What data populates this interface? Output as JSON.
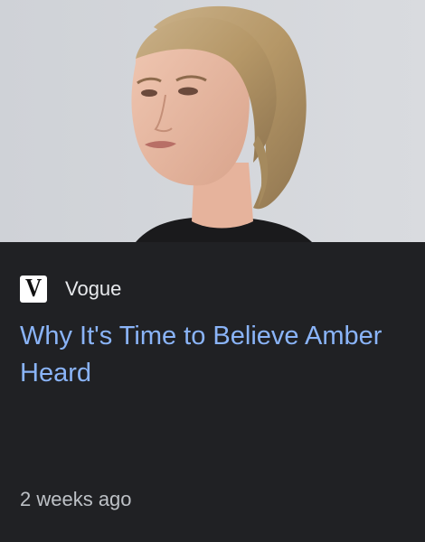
{
  "article": {
    "source": {
      "name": "Vogue",
      "logo_letter": "V"
    },
    "headline": "Why It's Time to Believe Amber Heard",
    "timestamp": "2 weeks ago"
  },
  "colors": {
    "background": "#202124",
    "headline": "#8ab4f8",
    "source_text": "#e8eaed",
    "timestamp_text": "#bdc1c6"
  }
}
